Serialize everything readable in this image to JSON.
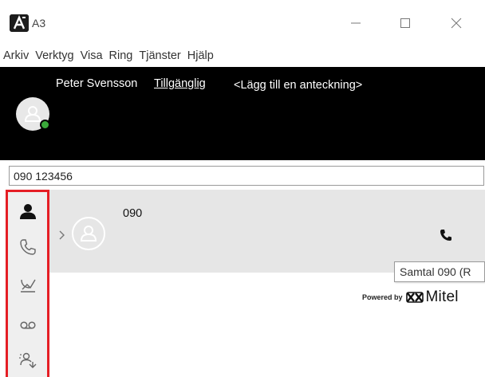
{
  "window": {
    "title": "A3",
    "logo_icon": "a3-logo-icon"
  },
  "menu": [
    "Arkiv",
    "Verktyg",
    "Visa",
    "Ring",
    "Tjänster",
    "Hjälp"
  ],
  "user": {
    "name": "Peter Svensson",
    "status": "Tillgänglig",
    "note": "<Lägg till en anteckning>",
    "presence_color": "#3aa93a"
  },
  "search": {
    "value": "090 123456"
  },
  "sidebar": {
    "highlight_color": "#e51e25",
    "items": [
      {
        "icon": "contact-person-icon"
      },
      {
        "icon": "phone-icon"
      },
      {
        "icon": "call-log-icon"
      },
      {
        "icon": "voicemail-icon"
      },
      {
        "icon": "group-redirect-icon"
      }
    ]
  },
  "contact": {
    "number": "090",
    "tooltip": "Samtal 090 (R"
  },
  "branding": {
    "powered_by": "Powered by",
    "company": "Mitel"
  }
}
